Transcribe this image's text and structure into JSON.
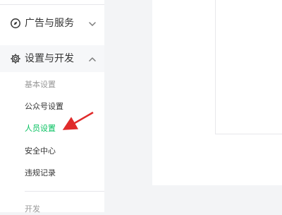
{
  "sidebar": {
    "groups": [
      {
        "label": "广告与服务",
        "icon": "compass-icon",
        "expanded": false,
        "chevron": "chevron-down-icon"
      },
      {
        "label": "设置与开发",
        "icon": "gear-icon",
        "expanded": true,
        "chevron": "chevron-up-icon",
        "items": [
          {
            "label": "基本设置",
            "state": "disabled"
          },
          {
            "label": "公众号设置",
            "state": "normal"
          },
          {
            "label": "人员设置",
            "state": "active"
          },
          {
            "label": "安全中心",
            "state": "normal"
          },
          {
            "label": "违规记录",
            "state": "normal"
          }
        ]
      }
    ],
    "bottom_label": "开发"
  },
  "annotation": {
    "arrow_color": "#e02b2b"
  },
  "colors": {
    "active": "#07c160",
    "text": "#353535",
    "muted": "#999999",
    "divider": "#e7e7eb",
    "sidebar_background": "#ffffff",
    "content_background": "#f3f4f6"
  }
}
